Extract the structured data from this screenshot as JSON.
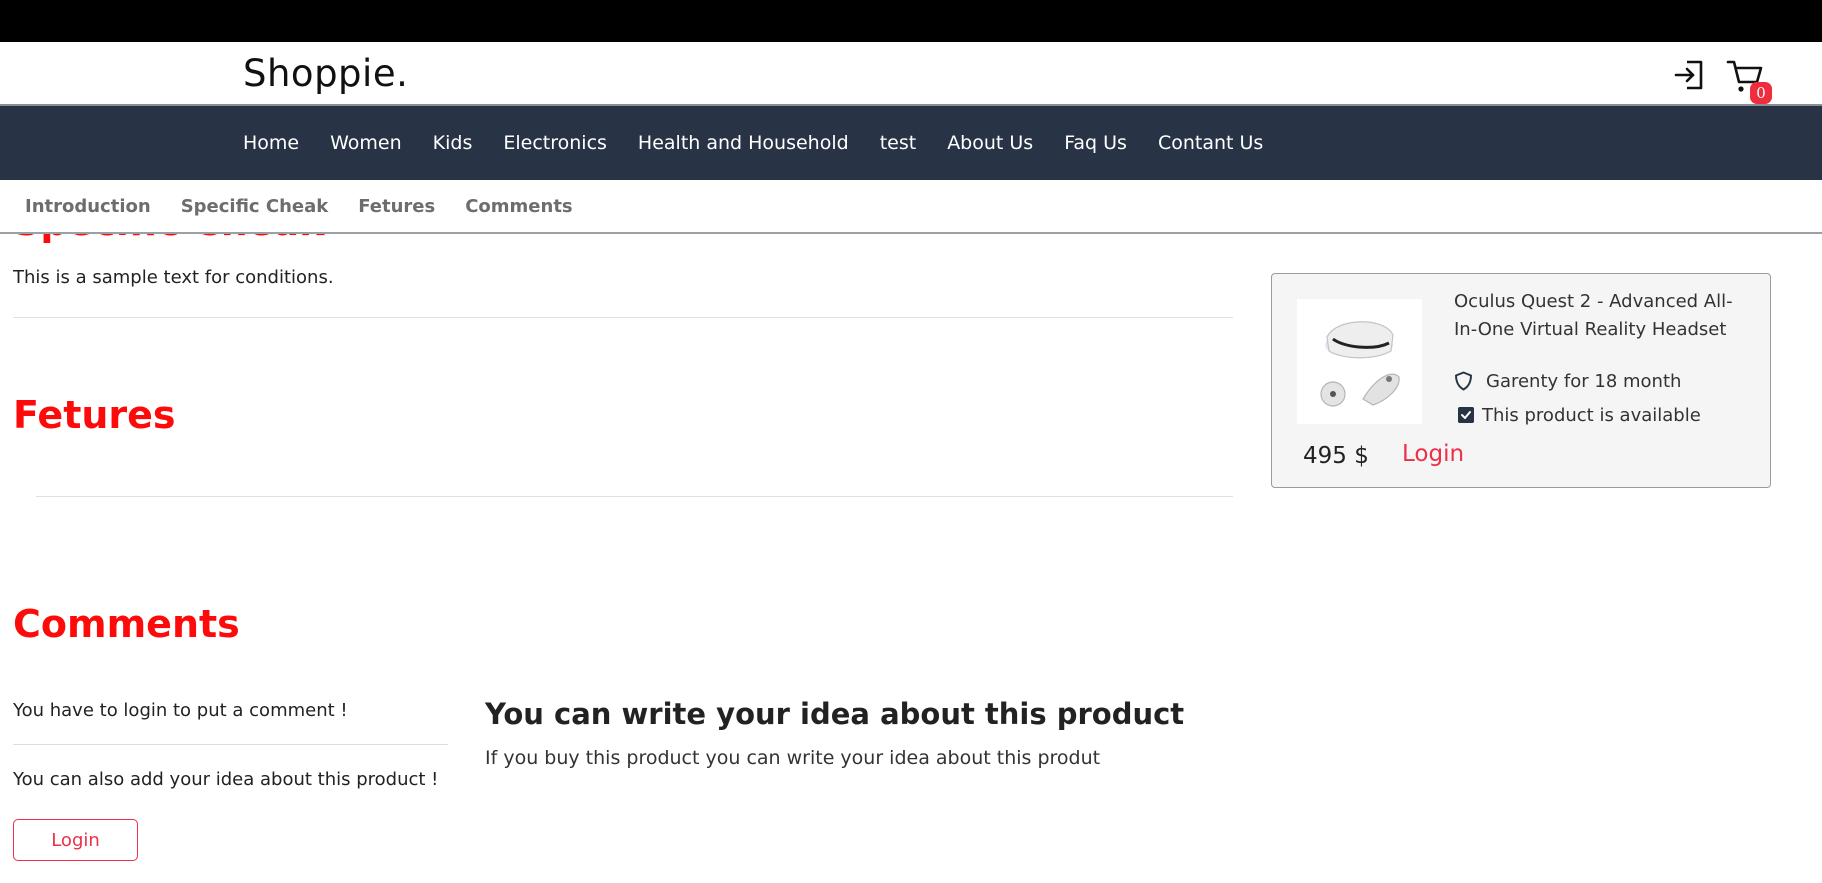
{
  "header": {
    "logo": "Shoppie.",
    "cart_count": "0",
    "icons": [
      "login-icon",
      "cart-icon"
    ]
  },
  "nav": {
    "items": [
      "Home",
      "Women",
      "Kids",
      "Electronics",
      "Health and Household",
      "test",
      "About Us",
      "Faq Us",
      "Contant Us"
    ]
  },
  "subnav": {
    "items": [
      "Introduction",
      "Specific Cheak",
      "Fetures",
      "Comments"
    ]
  },
  "main": {
    "specific_title": "Specific Cheak",
    "specific_text": "This is a sample text for conditions.",
    "features_title": "Fetures",
    "comments_title": "Comments",
    "comment_login_note": "You have to login to put a comment !",
    "comment_idea_note": "You can also add your idea about this product !",
    "comment_login_button": "Login",
    "idea_heading": "You can write your idea about this product",
    "idea_text": "If you buy this product you can write your idea about this produt"
  },
  "product_card": {
    "title": "Oculus Quest 2 - Advanced All-In-One Virtual Reality Headset",
    "warranty": "Garenty for 18 month",
    "availability": "This product is available",
    "price": "495 $",
    "login": "Login",
    "icons": [
      "shield-icon",
      "checkbox-icon"
    ]
  },
  "colors": {
    "accent": "#ff0a0a",
    "login_accent": "#ee2f48",
    "nav_bg": "#283445",
    "card_bg": "#f5f5f5"
  }
}
